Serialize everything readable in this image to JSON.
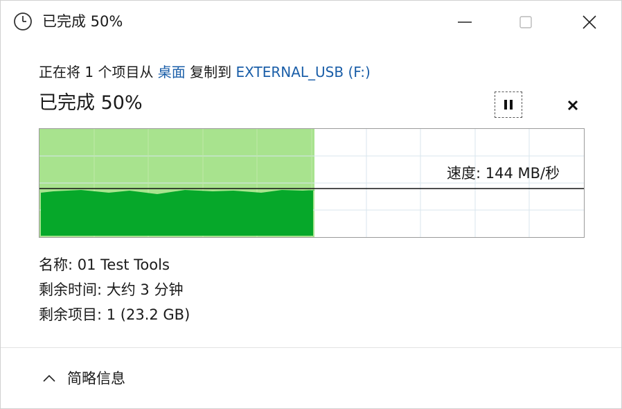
{
  "window": {
    "title": "已完成 50%",
    "icon": "clock-icon"
  },
  "copy": {
    "prefix": "正在将 1 个项目从 ",
    "source": "桌面",
    "middle": " 复制到 ",
    "destination": "EXTERNAL_USB (F:)"
  },
  "progress": {
    "text": "已完成 50%",
    "percent": 50,
    "speed_label": "速度: 144 MB/秒"
  },
  "details": {
    "name": "名称: 01 Test Tools",
    "time_remaining": "剩余时间: 大约 3 分钟",
    "items_remaining": "剩余项目: 1 (23.2 GB)"
  },
  "footer": {
    "toggle_label": "简略信息"
  },
  "colors": {
    "graph_light": "#a8e38e",
    "graph_dark": "#06a82a",
    "link": "#1a5ea8"
  }
}
